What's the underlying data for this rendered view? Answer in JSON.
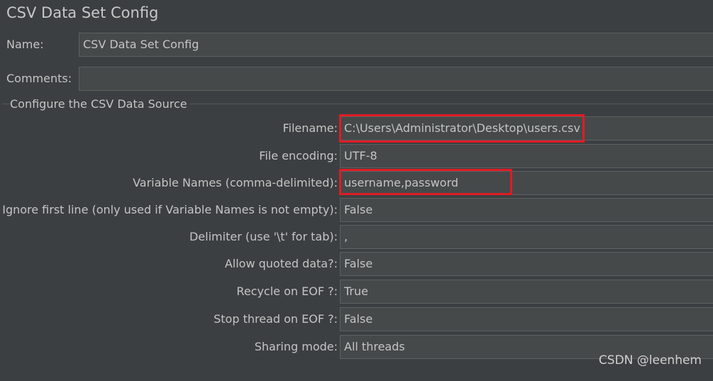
{
  "window": {
    "title": "CSV Data Set Config"
  },
  "name_field": {
    "label": "Name:",
    "value": "CSV Data Set Config"
  },
  "comments_field": {
    "label": "Comments:",
    "value": ""
  },
  "csv_source": {
    "title": "Configure the CSV Data Source",
    "fields": [
      {
        "label": "Filename:",
        "value": "C:\\Users\\Administrator\\Desktop\\users.csv",
        "highlighted": true
      },
      {
        "label": "File encoding:",
        "value": "UTF-8",
        "highlighted": false
      },
      {
        "label": "Variable Names (comma-delimited):",
        "value": "username,password",
        "highlighted": true
      },
      {
        "label": "Ignore first line (only used if Variable Names is not empty):",
        "value": "False",
        "highlighted": false
      },
      {
        "label": "Delimiter (use '\\t' for tab):",
        "value": ",",
        "highlighted": false
      },
      {
        "label": "Allow quoted data?:",
        "value": "False",
        "highlighted": false
      },
      {
        "label": "Recycle on EOF ?:",
        "value": "True",
        "highlighted": false
      },
      {
        "label": "Stop thread on EOF ?:",
        "value": "False",
        "highlighted": false
      },
      {
        "label": "Sharing mode:",
        "value": "All threads",
        "highlighted": false
      }
    ]
  },
  "watermark": {
    "text": "CSDN @leenhem"
  },
  "colors": {
    "background": "#3c3f41",
    "field_background": "#45494a",
    "field_border": "#5e6060",
    "text": "#c4c4c4",
    "highlight": "#e01b24"
  }
}
